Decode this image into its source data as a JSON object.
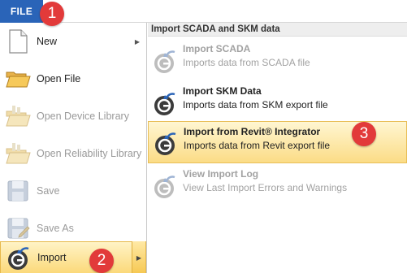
{
  "file_tab": {
    "label": "FILE"
  },
  "callouts": {
    "c1": "1",
    "c2": "2",
    "c3": "3"
  },
  "menu": {
    "items": [
      {
        "label": "New",
        "icon": "new-document-icon",
        "has_submenu": true,
        "enabled": true
      },
      {
        "label": "Open File",
        "icon": "open-folder-icon",
        "enabled": true
      },
      {
        "label": "Open Device Library",
        "icon": "device-library-icon",
        "enabled": false
      },
      {
        "label": "Open Reliability Library",
        "icon": "reliability-library-icon",
        "enabled": false
      },
      {
        "label": "Save",
        "icon": "save-disk-icon",
        "enabled": false
      },
      {
        "label": "Save As",
        "icon": "save-as-icon",
        "enabled": false
      },
      {
        "label": "Import",
        "icon": "import-icon",
        "has_submenu": true,
        "enabled": true,
        "selected": true
      }
    ]
  },
  "submenu": {
    "header": "Import SCADA and SKM data",
    "commands": [
      {
        "title": "Import SCADA",
        "description": "Imports data from SCADA file",
        "enabled": false
      },
      {
        "title": "Import SKM Data",
        "description": "Imports data from SKM export file",
        "enabled": true
      },
      {
        "title": "Import from Revit® Integrator",
        "description": "Imports data from Revit export file",
        "enabled": true,
        "highlighted": true
      },
      {
        "title": "View Import Log",
        "description": "View Last Import Errors and Warnings",
        "enabled": false
      }
    ]
  },
  "colors": {
    "file_tab": "#2a64b8",
    "callout": "#e23a3a",
    "highlight": "#fbd97a"
  }
}
